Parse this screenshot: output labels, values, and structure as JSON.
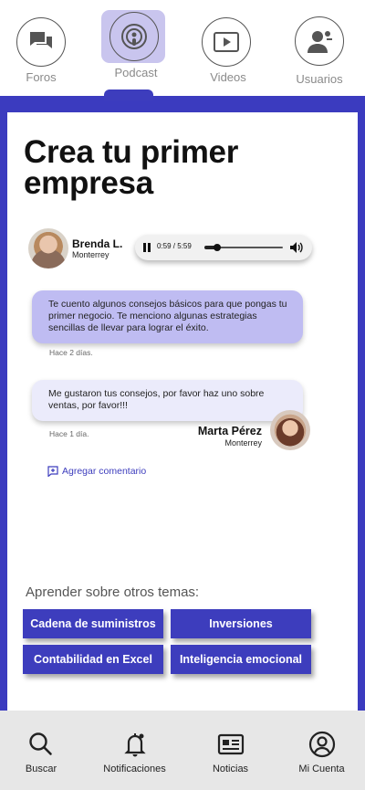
{
  "top_nav": {
    "items": [
      {
        "label": "Foros",
        "icon": "forum-icon"
      },
      {
        "label": "Podcast",
        "icon": "podcast-icon",
        "active": true
      },
      {
        "label": "Videos",
        "icon": "video-icon"
      },
      {
        "label": "Usuarios",
        "icon": "users-icon"
      }
    ]
  },
  "page": {
    "title": "Crea tu primer empresa"
  },
  "podcast": {
    "author": {
      "name": "Brenda L.",
      "city": "Monterrey"
    },
    "player": {
      "time": "0:59 / 5:59",
      "progress": 0.164
    }
  },
  "comments": [
    {
      "text": "Te cuento algunos consejos básicos para que pongas tu primer negocio. Te menciono algunas estrategias sencillas de llevar para lograr el éxito.",
      "time": "Hace 2 días."
    },
    {
      "text": "Me gustaron tus consejos, por favor haz uno sobre ventas, por favor!!!",
      "time": "Hace 1 día.",
      "author": {
        "name": "Marta Pérez",
        "city": "Monterrey"
      }
    }
  ],
  "add_comment_label": "Agregar comentario",
  "topics": {
    "heading": "Aprender sobre otros temas:",
    "items": [
      "Cadena de suministros",
      "Inversiones",
      "Contabilidad en Excel",
      "Inteligencia emocional"
    ]
  },
  "bottom_nav": {
    "items": [
      {
        "label": "Buscar",
        "icon": "search-icon"
      },
      {
        "label": "Notificaciones",
        "icon": "bell-icon"
      },
      {
        "label": "Noticias",
        "icon": "news-icon"
      },
      {
        "label": "Mi Cuenta",
        "icon": "account-icon"
      }
    ]
  },
  "colors": {
    "accent": "#3d3dbd",
    "bubble_primary": "#bfbcf2",
    "bubble_secondary": "#ebebfb",
    "active_tab_bg": "#c9c5ee"
  }
}
